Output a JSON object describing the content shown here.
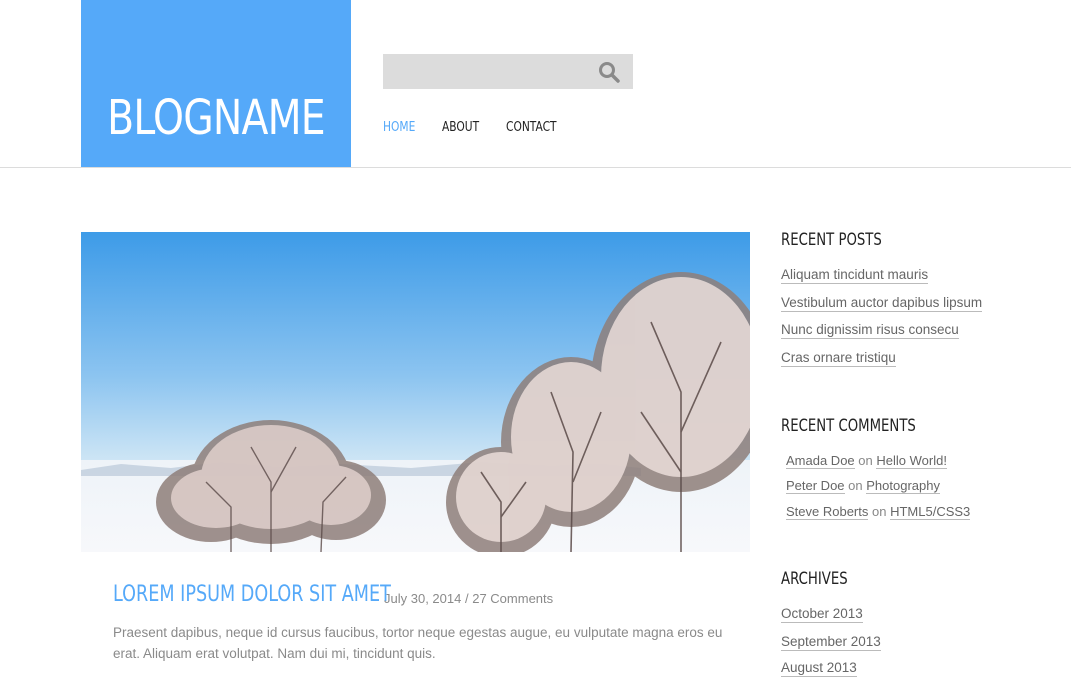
{
  "header": {
    "logo": "BLOGNAME",
    "search": {
      "placeholder": "",
      "value": ""
    },
    "nav": [
      {
        "label": "HOME",
        "active": true
      },
      {
        "label": "ABOUT",
        "active": false
      },
      {
        "label": "CONTACT",
        "active": false
      }
    ]
  },
  "post": {
    "title": "LOREM IPSUM DOLOR SIT AMET",
    "date": "July 30, 2014",
    "separator": "/",
    "comments": "27 Comments",
    "excerpt": "Praesent dapibus, neque id cursus faucibus, tortor neque egestas augue, eu vulputate magna eros eu erat. Aliquam erat volutpat. Nam dui mi, tincidunt quis."
  },
  "sidebar": {
    "recent_posts": {
      "title": "RECENT POSTS",
      "items": [
        "Aliquam tincidunt mauris",
        "Vestibulum auctor dapibus lipsum",
        "Nunc dignissim risus consecu",
        "Cras ornare tristiqu"
      ]
    },
    "recent_comments": {
      "title": "RECENT COMMENTS",
      "connector": "on",
      "items": [
        {
          "author": "Amada Doe",
          "post": "Hello World!"
        },
        {
          "author": "Peter Doe",
          "post": "Photography"
        },
        {
          "author": "Steve Roberts",
          "post": "HTML5/CSS3"
        }
      ]
    },
    "archives": {
      "title": "ARCHIVES",
      "items": [
        "October 2013",
        "September 2013",
        "August 2013"
      ]
    }
  },
  "colors": {
    "accent": "#55a9f9",
    "search_bg": "#dcdcdc",
    "text_muted": "#8a8a8a"
  },
  "icons": {
    "search": "search-icon"
  }
}
